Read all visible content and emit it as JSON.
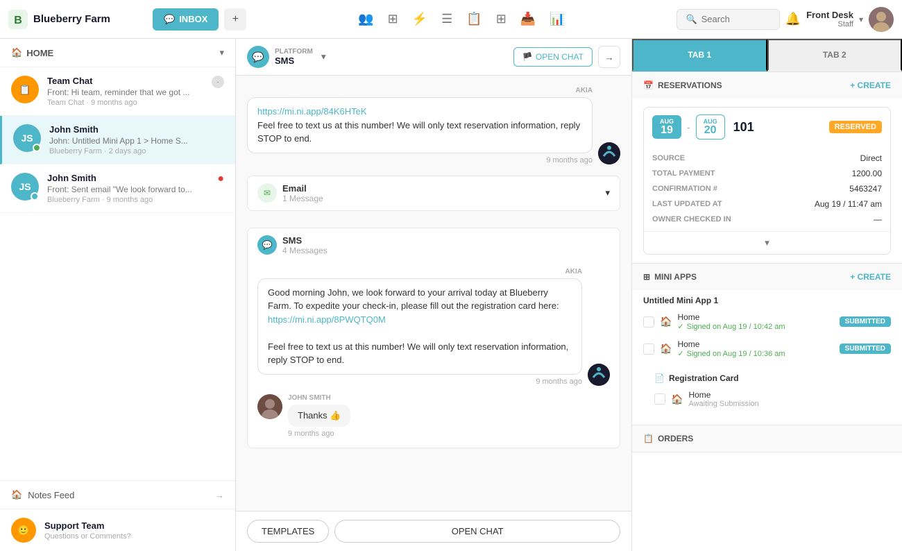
{
  "app": {
    "name": "Blueberry Farm",
    "logo_letter": "B"
  },
  "topnav": {
    "inbox_label": "INBOX",
    "plus_label": "+",
    "search_placeholder": "Search",
    "bell_icon": "🔔",
    "user": {
      "name": "Front Desk",
      "role": "Staff"
    }
  },
  "sidebar": {
    "home_label": "HOME",
    "conversations": [
      {
        "id": "team-chat",
        "name": "Team Chat",
        "preview": "Front: Hi team, reminder that we got ...",
        "meta": "Team Chat · 9 months ago",
        "icon_type": "orange",
        "icon_char": "📋",
        "has_badge": true
      },
      {
        "id": "john-smith-1",
        "name": "John Smith",
        "preview": "John: Untitled Mini App 1 > Home S...",
        "meta": "Blueberry Farm · 2 days ago",
        "icon_type": "teal-check",
        "active": true
      },
      {
        "id": "john-smith-2",
        "name": "John Smith",
        "preview": "Front: Sent email \"We look forward to...",
        "meta": "Blueberry Farm · 9 months ago",
        "icon_type": "teal-check-email",
        "has_urgent": true
      }
    ],
    "notes_feed_label": "Notes Feed",
    "support_team_label": "Support Team",
    "support_team_sub": "Questions or Comments?"
  },
  "chat": {
    "platform_label": "PLATFORM",
    "platform_name": "SMS",
    "open_chat_label": "OPEN CHAT",
    "sections": [
      {
        "type": "sms-collapsed",
        "title": "Email",
        "count": "1 Message",
        "icon_type": "email"
      },
      {
        "type": "sms-expanded",
        "title": "SMS",
        "count": "4 Messages"
      }
    ],
    "messages": [
      {
        "type": "outgoing",
        "sender": "AKIA",
        "link": "https://mi.ni.app/84K6HTeK",
        "body1": "Feel free to text us at this number! We will only text reservation information, reply STOP to end.",
        "timestamp": "9 months ago"
      },
      {
        "type": "outgoing",
        "sender": "AKIA",
        "link": "https://mi.ni.app/8PWQTQ0M",
        "body_pre": "Good morning John, we look forward to your arrival today at Blueberry Farm. To expedite your check-in, please fill out the registration card here:",
        "body_post": "Feel free to text us at this number! We will only text reservation information, reply STOP to end.",
        "timestamp": "9 months ago"
      },
      {
        "type": "incoming",
        "sender": "JOHN SMITH",
        "message": "Thanks 👍",
        "timestamp": "9 months ago"
      }
    ],
    "templates_label": "TEMPLATES",
    "open_chat_footer_label": "OPEN CHAT"
  },
  "right_panel": {
    "tab1_label": "TAB 1",
    "tab2_label": "TAB 2",
    "reservations": {
      "title": "RESERVATIONS",
      "create_label": "+ CREATE",
      "card": {
        "date_from_month": "AUG",
        "date_from_day": "19",
        "date_to_month": "AUG",
        "date_to_day": "20",
        "number": "101",
        "status": "RESERVED",
        "source_label": "SOURCE",
        "source_value": "Direct",
        "total_payment_label": "TOTAL PAYMENT",
        "total_payment_value": "1200.00",
        "confirmation_label": "CONFIRMATION #",
        "confirmation_value": "5463247",
        "last_updated_label": "LAST UPDATED AT",
        "last_updated_value": "Aug 19 / 11:47 am",
        "owner_checked_label": "OWNER CHECKED IN",
        "owner_checked_value": "—"
      }
    },
    "mini_apps": {
      "title": "MINI APPS",
      "create_label": "+ CREATE",
      "app_title": "Untitled Mini App 1",
      "items": [
        {
          "name": "Home",
          "signed": "Signed on Aug 19 / 10:42 am",
          "status": "SUBMITTED"
        },
        {
          "name": "Home",
          "signed": "Signed on Aug 19 / 10:36 am",
          "status": "SUBMITTED"
        }
      ],
      "reg_card": {
        "title": "Registration Card",
        "items": [
          {
            "name": "Home",
            "status": "Awaiting Submission"
          }
        ]
      }
    },
    "orders": {
      "title": "ORDERS"
    }
  }
}
